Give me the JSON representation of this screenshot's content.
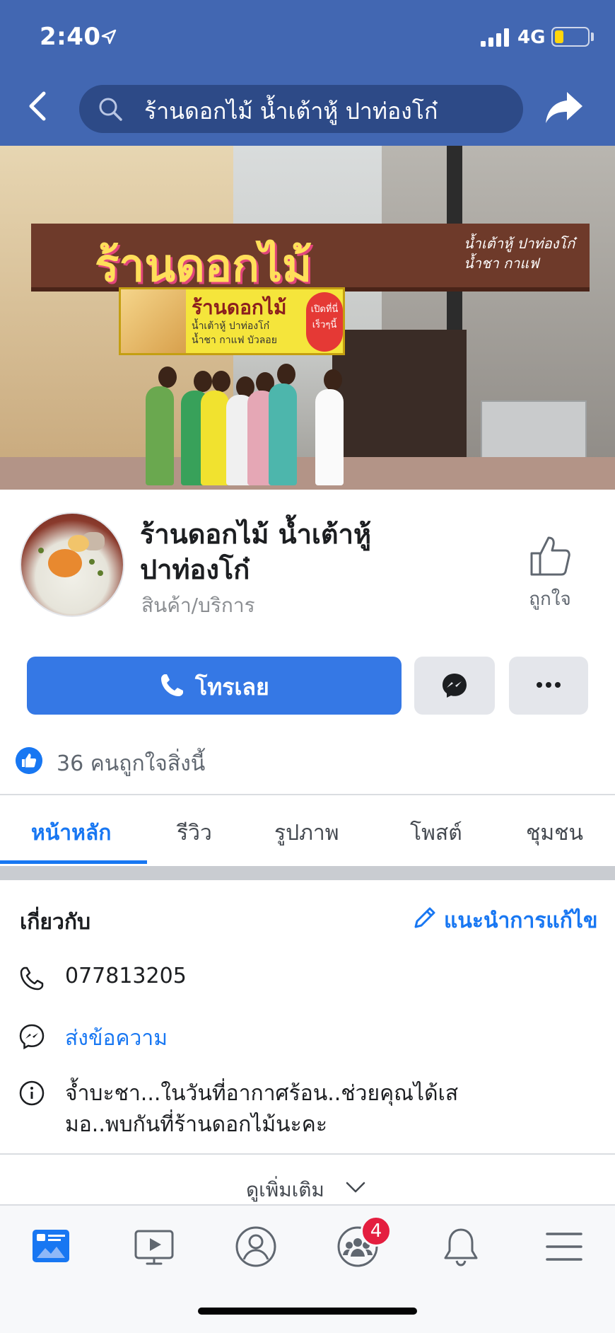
{
  "status_bar": {
    "time": "2:40",
    "network": "4G",
    "location_icon": "location-arrow-icon",
    "signal_icon": "signal-bars-icon",
    "battery_icon": "battery-low-icon"
  },
  "header": {
    "search_text": "ร้านดอกไม้ น้ำเต้าหู้ ปาท่องโก๋",
    "back_icon": "chevron-left-icon",
    "share_icon": "share-arrow-icon",
    "background_color": "#4267b2"
  },
  "cover": {
    "sign_title": "ร้านดอกไม้",
    "sign_right_line1": "น้ำเต้าหู้ ปาท่องโก๋",
    "sign_right_line2": "น้ำชา กาแฟ",
    "banner_title": "ร้านดอกไม้",
    "banner_line1": "น้ำเต้าหู้ ปาท่องโก๋",
    "banner_line2": "น้ำชา กาแฟ บัวลอย",
    "banner_badge": "เปิดที่นี่ เร็วๆนี้"
  },
  "page": {
    "name": "ร้านดอกไม้ น้ำเต้าหู้ ปาท่องโก๋",
    "category": "สินค้า/บริการ",
    "like_label": "ถูกใจ",
    "call_label": "โทรเลย",
    "likes_count_text": "36 คนถูกใจสิ่งนี้",
    "accent_color": "#1877f2",
    "call_button_color": "#3578e5"
  },
  "tabs": [
    {
      "label": "หน้าหลัก",
      "active": true
    },
    {
      "label": "รีวิว",
      "active": false
    },
    {
      "label": "รูปภาพ",
      "active": false
    },
    {
      "label": "โพสต์",
      "active": false
    },
    {
      "label": "ชุมชน",
      "active": false
    }
  ],
  "about": {
    "title": "เกี่ยวกับ",
    "suggest_edit": "แนะนำการแก้ไข",
    "phone": "077813205",
    "message_link": "ส่งข้อความ",
    "description_line1": "จ้ำบะชา...ในวันที่อากาศร้อน..ช่วยคุณได้เส",
    "description_line2": "มอ..พบกันที่ร้านดอกไม้นะคะ",
    "see_more": "ดูเพิ่มเติม"
  },
  "bottom_nav": {
    "items": [
      {
        "icon": "news-feed-icon",
        "active": true
      },
      {
        "icon": "watch-video-icon",
        "active": false
      },
      {
        "icon": "profile-icon",
        "active": false
      },
      {
        "icon": "groups-icon",
        "active": false,
        "badge": "4"
      },
      {
        "icon": "notifications-bell-icon",
        "active": false
      },
      {
        "icon": "menu-hamburger-icon",
        "active": false
      }
    ]
  }
}
